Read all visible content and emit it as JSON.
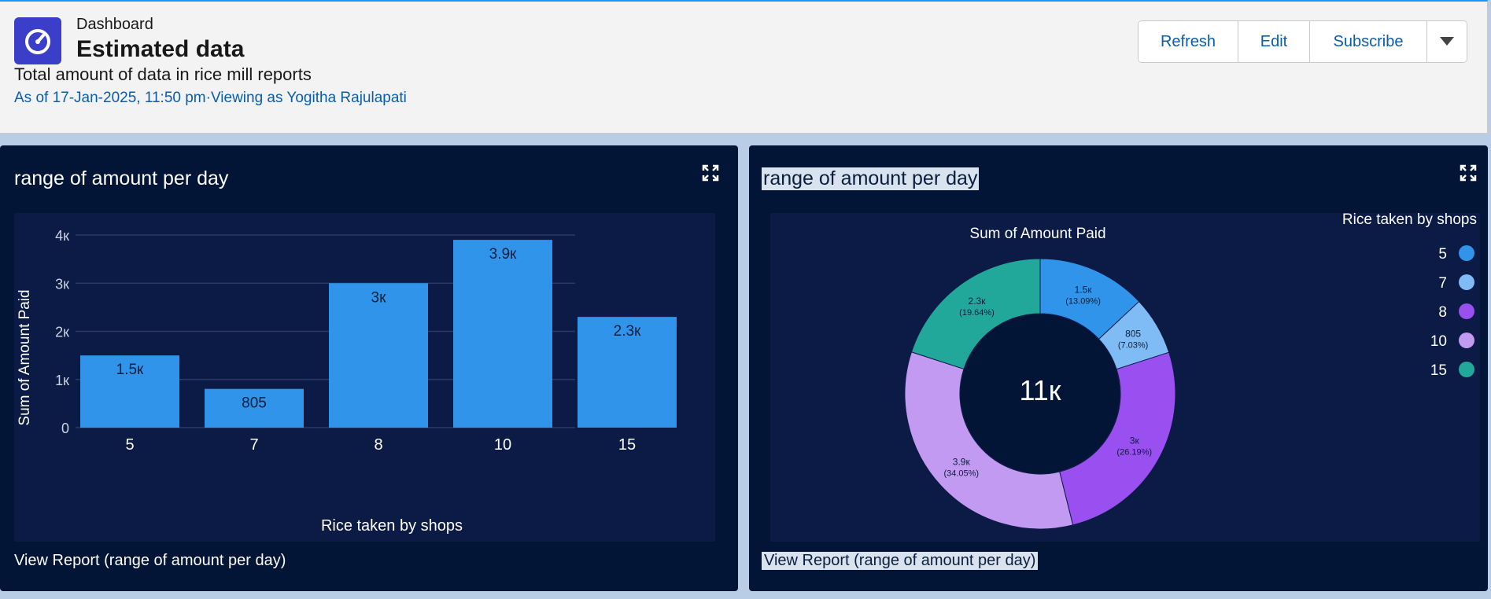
{
  "header": {
    "breadcrumb": "Dashboard",
    "title": "Estimated data",
    "description": "Total amount of data in rice mill reports",
    "as_of": "As of 17-Jan-2025, 11:50 pm·Viewing as Yogitha Rajulapati",
    "buttons": {
      "refresh": "Refresh",
      "edit": "Edit",
      "subscribe": "Subscribe"
    },
    "icons": {
      "app": "gauge-icon",
      "menu": "chevron-down-icon"
    },
    "colors": {
      "app_icon": "#3a3ec8",
      "link": "#0b5cab"
    }
  },
  "panels": [
    {
      "title": "range of amount per day",
      "view_report": "View Report (range of amount per day)",
      "expand_icon": "expand-icon"
    },
    {
      "title": "range of amount per day",
      "view_report": "View Report (range of amount per day)",
      "expand_icon": "expand-icon"
    }
  ],
  "chart_data": [
    {
      "type": "bar",
      "categories": [
        "5",
        "7",
        "8",
        "10",
        "15"
      ],
      "values": [
        1500,
        805,
        3000,
        3900,
        2300
      ],
      "value_labels": [
        "1.5к",
        "805",
        "3к",
        "3.9к",
        "2.3к"
      ],
      "xlabel": "Rice taken by shops",
      "ylabel": "Sum of Amount Paid",
      "ylim": [
        0,
        4000
      ],
      "yticks": [
        0,
        1000,
        2000,
        3000,
        4000
      ],
      "ytick_labels": [
        "0",
        "1к",
        "2к",
        "3к",
        "4к"
      ],
      "grid": true,
      "color": "#2f94ea"
    },
    {
      "type": "pie",
      "variant": "donut",
      "title": "Sum of Amount Paid",
      "center_label": "11к",
      "legend_title": "Rice taken by shops",
      "legend_position": "top-right",
      "slices": [
        {
          "label": "5",
          "value": 1500,
          "value_label": "1.5к",
          "percent": "(13.09%)",
          "color": "#2f94ea"
        },
        {
          "label": "7",
          "value": 805,
          "value_label": "805",
          "percent": "(7.03%)",
          "color": "#7fbcf6"
        },
        {
          "label": "8",
          "value": 3000,
          "value_label": "3к",
          "percent": "(26.19%)",
          "color": "#9a4ff0"
        },
        {
          "label": "10",
          "value": 3900,
          "value_label": "3.9к",
          "percent": "(34.05%)",
          "color": "#c39af2"
        },
        {
          "label": "15",
          "value": 2300,
          "value_label": "2.3к",
          "percent": "(19.64%)",
          "color": "#22a89a"
        }
      ]
    }
  ]
}
